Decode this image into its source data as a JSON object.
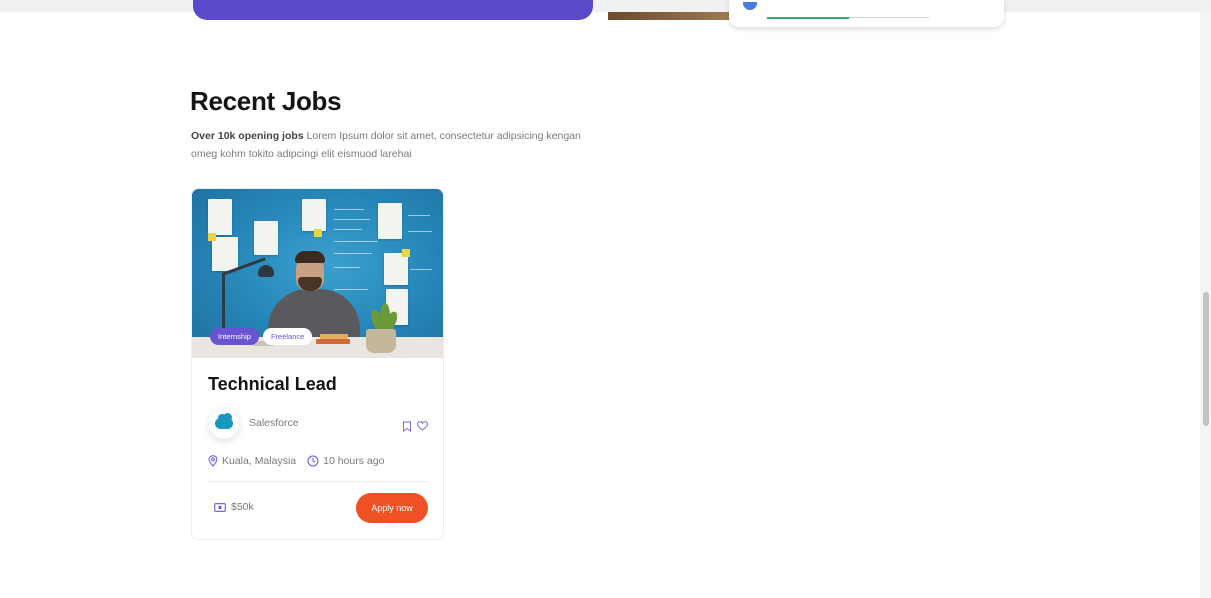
{
  "section": {
    "title": "Recent Jobs",
    "desc_strong": "Over 10k opening jobs",
    "desc_rest": " Lorem Ipsum dolor sit amet, consectetur adipsicing kengan omeg kohm tokito adipcingi elit eismuod larehai"
  },
  "job": {
    "tags": [
      "Internship",
      "Freelance"
    ],
    "title": "Technical Lead",
    "company": "Salesforce",
    "location": "Kuala, Malaysia",
    "posted": "10 hours ago",
    "salary": "$50k",
    "apply_label": "Apply now"
  },
  "icons": {
    "bookmark": "bookmark-icon",
    "favorite": "heart-icon",
    "location": "map-pin-icon",
    "time": "clock-icon",
    "salary": "money-icon"
  },
  "colors": {
    "accent_purple": "#6a54d0",
    "apply_orange": "#ef5125",
    "salesforce_blue": "#1798c1"
  }
}
